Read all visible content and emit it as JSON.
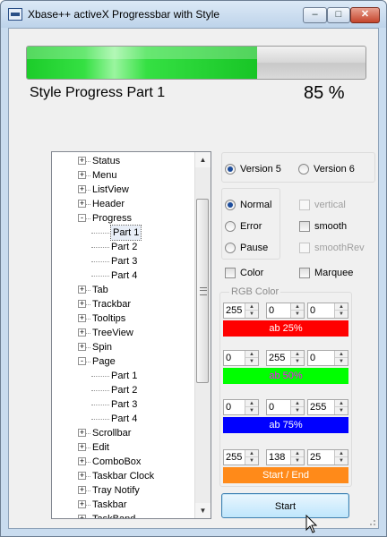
{
  "window": {
    "title": "Xbase++ activeX Progressbar with Style",
    "icons": {
      "app": "app-window-icon",
      "minimize": "minimize-icon",
      "maximize": "maximize-icon",
      "close": "close-icon"
    },
    "glyphs": {
      "minimize": "–",
      "maximize": "□",
      "close": "✕"
    }
  },
  "progress": {
    "value": 0.68,
    "label": "Style Progress Part  1",
    "percent_text": "85 %",
    "fill_color": "#2ad838"
  },
  "tree": {
    "items": [
      {
        "label": "Status",
        "expander": "+"
      },
      {
        "label": "Menu",
        "expander": "+"
      },
      {
        "label": "ListView",
        "expander": "+"
      },
      {
        "label": "Header",
        "expander": "+"
      },
      {
        "label": "Progress",
        "expander": "-"
      },
      {
        "label": "Part 1",
        "expander": ""
      },
      {
        "label": "Part 2",
        "expander": ""
      },
      {
        "label": "Part 3",
        "expander": ""
      },
      {
        "label": "Part 4",
        "expander": ""
      },
      {
        "label": "Tab",
        "expander": "+"
      },
      {
        "label": "Trackbar",
        "expander": "+"
      },
      {
        "label": "Tooltips",
        "expander": "+"
      },
      {
        "label": "TreeView",
        "expander": "+"
      },
      {
        "label": "Spin",
        "expander": "+"
      },
      {
        "label": "Page",
        "expander": "-"
      },
      {
        "label": "Part 1",
        "expander": ""
      },
      {
        "label": "Part 2",
        "expander": ""
      },
      {
        "label": "Part 3",
        "expander": ""
      },
      {
        "label": "Part 4",
        "expander": ""
      },
      {
        "label": "Scrollbar",
        "expander": "+"
      },
      {
        "label": "Edit",
        "expander": "+"
      },
      {
        "label": "ComboBox",
        "expander": "+"
      },
      {
        "label": "Taskbar Clock",
        "expander": "+"
      },
      {
        "label": "Tray Notify",
        "expander": "+"
      },
      {
        "label": "Taskbar",
        "expander": "+"
      },
      {
        "label": "TaskBand",
        "expander": "+"
      }
    ],
    "selected_label": "Part 1",
    "scroll": {
      "up_glyph": "▲",
      "down_glyph": "▼"
    }
  },
  "version": {
    "options": [
      "Version 5",
      "Version 6"
    ],
    "selected": "Version 5"
  },
  "state": {
    "options": [
      "Normal",
      "Error",
      "Pause"
    ],
    "selected": "Normal"
  },
  "checks": {
    "vertical": {
      "label": "vertical",
      "checked": false,
      "enabled": false
    },
    "smooth": {
      "label": "smooth",
      "checked": false,
      "enabled": true
    },
    "smoothrev": {
      "label": "smoothRev",
      "checked": false,
      "enabled": false
    },
    "color": {
      "label": "Color",
      "checked": false,
      "enabled": true
    },
    "marquee": {
      "label": "Marquee",
      "checked": false,
      "enabled": true
    }
  },
  "rgb": {
    "legend": "RGB Color",
    "rows": [
      {
        "r": "255",
        "g": "0",
        "b": "0",
        "bar_label": "ab 25%",
        "bar_color": "#ff0000",
        "text_color": "#ffffff"
      },
      {
        "r": "0",
        "g": "255",
        "b": "0",
        "bar_label": "ab 50%",
        "bar_color": "#00ff00",
        "text_color": "#ff00ff"
      },
      {
        "r": "0",
        "g": "0",
        "b": "255",
        "bar_label": "ab 75%",
        "bar_color": "#0000ff",
        "text_color": "#ffffff"
      },
      {
        "r": "255",
        "g": "138",
        "b": "25",
        "bar_label": "Start / End",
        "bar_color": "#ff8a19",
        "text_color": "#ffffff"
      }
    ]
  },
  "start_button": {
    "label": "Start"
  }
}
